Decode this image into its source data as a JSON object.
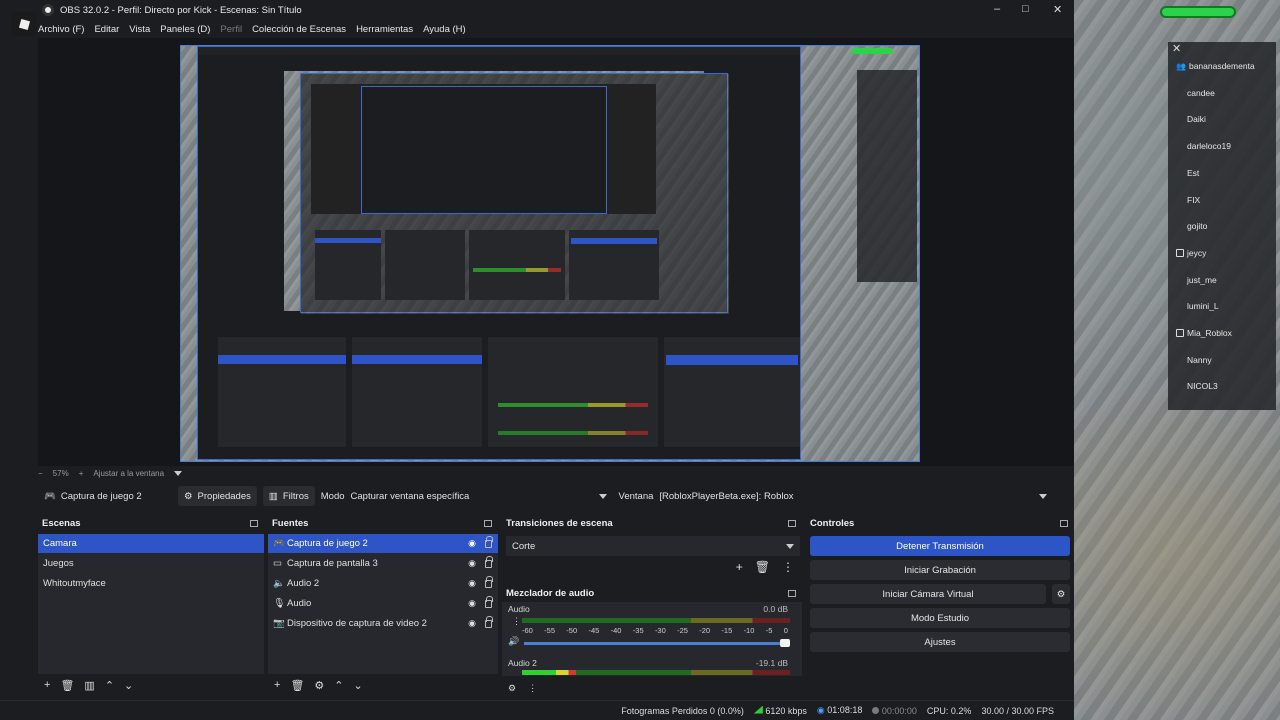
{
  "window": {
    "title": "OBS 32.0.2 - Perfil: Directo por Kick - Escenas: Sin Título",
    "controls": [
      "–",
      "□",
      "✕"
    ]
  },
  "menu": [
    {
      "label": "Archivo (F)",
      "enabled": true
    },
    {
      "label": "Editar",
      "enabled": true
    },
    {
      "label": "Vista",
      "enabled": true
    },
    {
      "label": "Paneles (D)",
      "enabled": true
    },
    {
      "label": "Perfil",
      "enabled": false
    },
    {
      "label": "Colección de Escenas",
      "enabled": true
    },
    {
      "label": "Herramientas",
      "enabled": true
    },
    {
      "label": "Ayuda (H)",
      "enabled": true
    }
  ],
  "preview": {
    "zoom": "57%",
    "fit_label": "Ajustar a la ventana"
  },
  "source_toolbar": {
    "source_name": "Captura de juego 2",
    "properties_label": "Propiedades",
    "filters_label": "Filtros",
    "mode_label": "Modo",
    "mode_value": "Capturar ventana específica",
    "window_label": "Ventana",
    "window_value": "[RobloxPlayerBeta.exe]: Roblox"
  },
  "scenes": {
    "title": "Escenas",
    "items": [
      "Camara",
      "Juegos",
      "Whitoutmyface"
    ],
    "selected": 0
  },
  "sources": {
    "title": "Fuentes",
    "items": [
      {
        "label": "Captura de juego 2",
        "icon": "gamepad-icon"
      },
      {
        "label": "Captura de pantalla 3",
        "icon": "monitor-icon"
      },
      {
        "label": "Audio 2",
        "icon": "speaker-icon"
      },
      {
        "label": "Audio",
        "icon": "microphone-icon"
      },
      {
        "label": "Dispositivo de captura de video 2",
        "icon": "camera-icon"
      }
    ],
    "selected": 0
  },
  "transitions": {
    "title": "Transiciones de escena",
    "value": "Corte"
  },
  "mixer": {
    "title": "Mezclador de audio",
    "channels": [
      {
        "name": "Audio",
        "db": "0.0 dB",
        "level": 0.0
      },
      {
        "name": "Audio 2",
        "db": "-19.1 dB",
        "level": 0.2
      }
    ],
    "scale": [
      "-60",
      "-55",
      "-50",
      "-45",
      "-40",
      "-35",
      "-30",
      "-25",
      "-20",
      "-15",
      "-10",
      "-5",
      "0"
    ]
  },
  "controls": {
    "title": "Controles",
    "buttons": [
      "Detener Transmisión",
      "Iniciar Grabación",
      "Iniciar Cámara Virtual",
      "Modo Estudio",
      "Ajustes"
    ]
  },
  "status": {
    "dropped": "Fotogramas Perdidos 0 (0.0%)",
    "bitrate": "6120 kbps",
    "stream_time": "01:08:18",
    "rec_time": "00:00:00",
    "cpu": "CPU: 0.2%",
    "fps": "30.00 / 30.00 FPS"
  },
  "viewers": {
    "items": [
      {
        "name": "bananasdementa",
        "icon": "users-icon"
      },
      {
        "name": "candee",
        "icon": ""
      },
      {
        "name": "Daiki",
        "icon": ""
      },
      {
        "name": "darleloco19",
        "icon": ""
      },
      {
        "name": "Est",
        "icon": ""
      },
      {
        "name": "FIX",
        "icon": ""
      },
      {
        "name": "gojito",
        "icon": ""
      },
      {
        "name": "jeycy",
        "icon": "badge-icon"
      },
      {
        "name": "just_me",
        "icon": ""
      },
      {
        "name": "lumini_L",
        "icon": ""
      },
      {
        "name": "Mia_Roblox",
        "icon": "badge-icon"
      },
      {
        "name": "Nanny",
        "icon": ""
      },
      {
        "name": "NICOL3",
        "icon": ""
      }
    ]
  },
  "colors": {
    "accent": "#2e55c8",
    "panel": "#1c1d21",
    "panel_dark": "#27282d"
  }
}
